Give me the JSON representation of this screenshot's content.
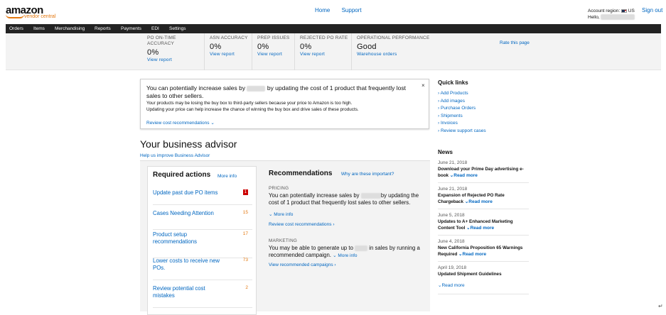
{
  "brand": {
    "logo": "amazon",
    "sub": "vendor central"
  },
  "top_links": [
    "Home",
    "Support"
  ],
  "account": {
    "region_label": "Account region:",
    "region": "US",
    "hello": "Hello,",
    "sign_out": "Sign out"
  },
  "nav": [
    "Orders",
    "Items",
    "Merchandising",
    "Reports",
    "Payments",
    "EDI",
    "Settings"
  ],
  "metrics": [
    {
      "label": "PO ON-TIME ACCURACY",
      "value": "0%",
      "link": "View report"
    },
    {
      "label": "ASN ACCURACY",
      "value": "0%",
      "link": "View report"
    },
    {
      "label": "PREP ISSUES",
      "value": "0%",
      "link": "View report"
    },
    {
      "label": "REJECTED PO RATE",
      "value": "0%",
      "link": "View report"
    },
    {
      "label": "OPERATIONAL PERFORMANCE",
      "value": "Good",
      "link": "Warehouse orders"
    }
  ],
  "rate_page": "Rate this page",
  "alert": {
    "main_pre": "You can potentially increase sales by",
    "main_post": "by updating the cost of 1 product that frequently lost sales to other sellers.",
    "sub1": "Your products may be losing the buy box to third-party sellers because your price to Amazon is too high.",
    "sub2": "Updating your price can help increase the chance of winning the buy box and drive sales of these products.",
    "review": "Review cost recommendations",
    "close": "×"
  },
  "quick_links": {
    "title": "Quick links",
    "items": [
      "Add Products",
      "Add images",
      "Purchase Orders",
      "Shipments",
      "Invoices",
      "Review support cases"
    ]
  },
  "news": {
    "title": "News",
    "items": [
      {
        "date": "June 21, 2018",
        "title": "Download your Prime Day advertising e-book",
        "more": "Read more"
      },
      {
        "date": "June 21, 2018",
        "title": "Expansion of Rejected PO Rate Chargeback",
        "more": "Read more"
      },
      {
        "date": "June 5, 2018",
        "title": "Updates to A+ Enhanced Marketing Content Tool",
        "more": "Read more"
      },
      {
        "date": "June 4, 2018",
        "title": "New California Proposition 65 Warnings Required",
        "more": "Read more"
      },
      {
        "date": "April 19, 2018",
        "title": "Updated Shipment Guidelines",
        "more": "Read more"
      }
    ]
  },
  "advisor": {
    "title": "Your business advisor",
    "help": "Help us improve Business Advisor",
    "required": {
      "title": "Required actions",
      "more": "More info",
      "items": [
        {
          "label": "Update past due PO items",
          "count": "1"
        },
        {
          "label": "Cases Needing Attention",
          "count": "15"
        },
        {
          "label": "Product setup recommendations",
          "count": "17"
        },
        {
          "label": "Lower costs to receive new POs.",
          "count": "73"
        },
        {
          "label": "Review potential cost mistakes",
          "count": "2"
        }
      ]
    },
    "recommendations": {
      "title": "Recommendations",
      "why": "Why are these important?",
      "pricing": {
        "cap": "PRICING",
        "pre": "You can potentially increase sales by",
        "post": "by updating the cost of 1 product that frequently lost sales to other sellers.",
        "more": "More info",
        "link": "Review cost recommendations"
      },
      "marketing": {
        "cap": "MARKETING",
        "pre": "You may be able to generate up to",
        "post": "in sales by running a recommended campaign.",
        "more": "More info",
        "link": "View recommended campaigns"
      }
    }
  }
}
